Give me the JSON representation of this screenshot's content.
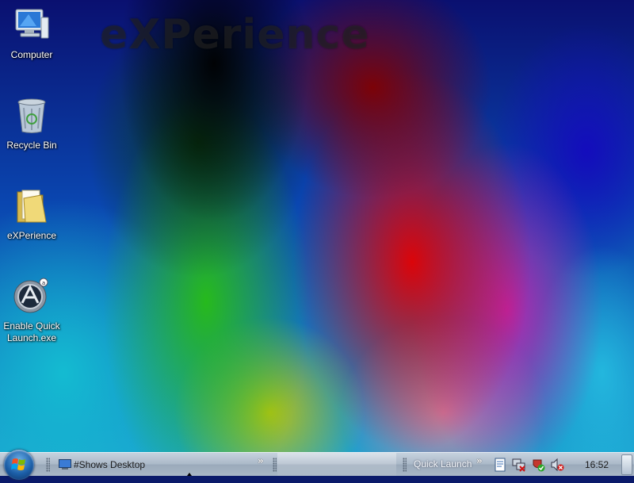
{
  "watermark": "eXPerience",
  "desktop_icons": [
    {
      "label": "Computer",
      "icon": "computer-icon"
    },
    {
      "label": "Recycle Bin",
      "icon": "recycle-bin-icon"
    },
    {
      "label": "eXPerience",
      "icon": "folder-icon"
    },
    {
      "label": "Enable Quick Launch.exe",
      "icon": "app-executable-icon"
    }
  ],
  "taskbar": {
    "start_icon": "windows-start-orb-icon",
    "task_button_label": "#Shows Desktop",
    "overflow_chevron": "»",
    "quick_launch_label": "Quick Launch",
    "tray_icons": [
      "document-icon",
      "network-icon",
      "security-check-icon",
      "volume-muted-icon"
    ],
    "clock": "16:52"
  }
}
